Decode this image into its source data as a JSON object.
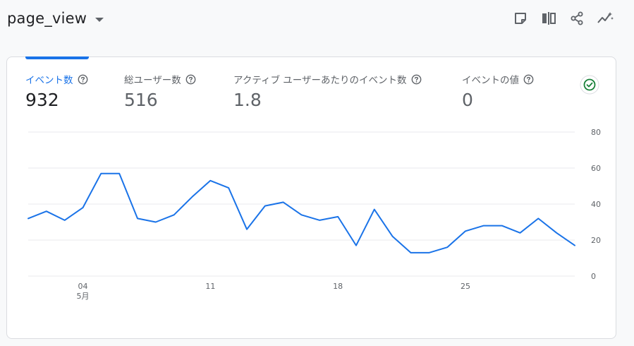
{
  "header": {
    "event_name": "page_view",
    "toolbar": [
      {
        "name": "note-icon"
      },
      {
        "name": "compare-icon"
      },
      {
        "name": "share-icon"
      },
      {
        "name": "insights-icon"
      }
    ]
  },
  "metrics": [
    {
      "label": "イベント数",
      "value": "932",
      "active": true
    },
    {
      "label": "総ユーザー数",
      "value": "516",
      "active": false
    },
    {
      "label": "アクティブ ユーザーあたりのイベント数",
      "value": "1.8",
      "active": false
    },
    {
      "label": "イベントの値",
      "value": "0",
      "active": false
    }
  ],
  "colors": {
    "accent": "#1a73e8",
    "success": "#188038",
    "muted": "#5f6368",
    "grid": "#e8eaed"
  },
  "chart_data": {
    "type": "line",
    "series": [
      {
        "values": [
          32,
          36,
          31,
          38,
          57,
          57,
          32,
          30,
          34,
          44,
          53,
          49,
          26,
          39,
          41,
          34,
          31,
          33,
          17,
          37,
          22,
          13,
          13,
          16,
          25,
          28,
          28,
          24,
          32,
          24,
          17
        ]
      }
    ],
    "x_tick_labels": [
      {
        "index": 3,
        "label": "04",
        "sublabel": "5月"
      },
      {
        "index": 10,
        "label": "11"
      },
      {
        "index": 17,
        "label": "18"
      },
      {
        "index": 24,
        "label": "25"
      }
    ],
    "ylim": [
      0,
      80
    ],
    "y_ticks": [
      "0",
      "20",
      "40",
      "60",
      "80"
    ],
    "grid": true,
    "y_axis_position": "right"
  }
}
